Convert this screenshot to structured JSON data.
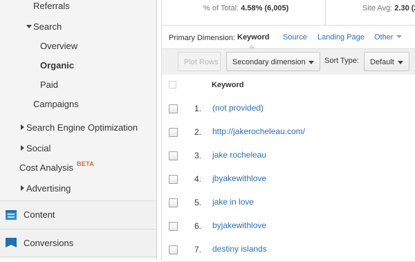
{
  "sidebar": {
    "referrals": "Referrals",
    "search": "Search",
    "overview": "Overview",
    "organic": "Organic",
    "paid": "Paid",
    "campaigns": "Campaigns",
    "seo": "Search Engine Optimization",
    "social": "Social",
    "cost_analysis": "Cost Analysis",
    "beta": "BETA",
    "advertising": "Advertising",
    "content": "Content",
    "conversions": "Conversions"
  },
  "stats": {
    "total_prefix": "% of Total:",
    "total_value": "4.58% (6,005)",
    "site_avg_prefix": "Site Avg:",
    "site_avg_value": "2.30 (2"
  },
  "dimension": {
    "label": "Primary Dimension:",
    "active": "Keyword",
    "options": [
      "Source",
      "Landing Page",
      "Other"
    ]
  },
  "toolbar": {
    "plot_rows": "Plot Rows",
    "secondary_dimension": "Secondary dimension",
    "sort_type_label": "Sort Type:",
    "sort_type_value": "Default"
  },
  "table": {
    "column": "Keyword",
    "rows": [
      {
        "n": "1.",
        "keyword": "(not provided)"
      },
      {
        "n": "2.",
        "keyword": "http://jakerocheleau.com/"
      },
      {
        "n": "3.",
        "keyword": "jake rocheleau"
      },
      {
        "n": "4.",
        "keyword": "jbyakewithlove"
      },
      {
        "n": "5.",
        "keyword": "jake in love"
      },
      {
        "n": "6.",
        "keyword": "byjakewithlove"
      },
      {
        "n": "7.",
        "keyword": "destiny islands"
      }
    ]
  },
  "colors": {
    "link": "#2a6ebb",
    "beta": "#dd6b2a",
    "content_icon": "#2b8fd6",
    "conversions_icon": "#1f6eb8"
  },
  "icons": {
    "content": "content-icon",
    "conversions": "flag-icon"
  }
}
